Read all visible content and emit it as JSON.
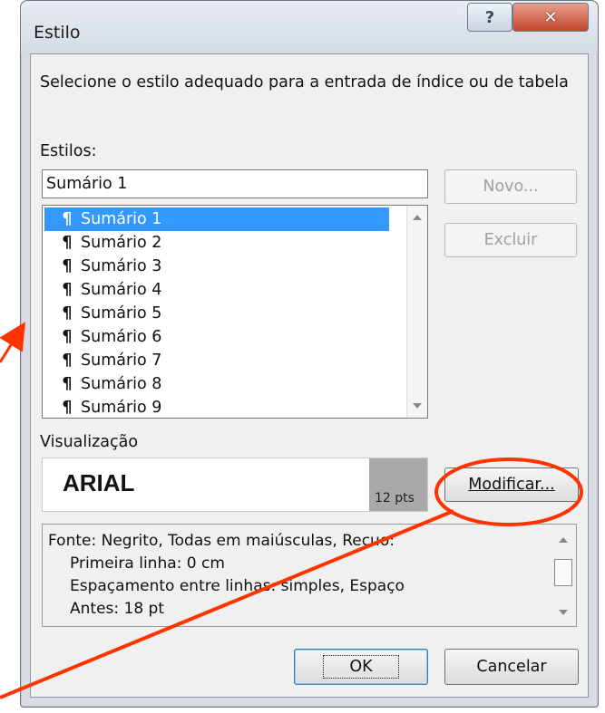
{
  "window": {
    "title": "Estilo"
  },
  "instruction": "Selecione o estilo adequado para a entrada de índice ou de tabela",
  "styles_label": "Estilos:",
  "style_input_value": "Sumário 1",
  "style_list": [
    "Sumário 1",
    "Sumário 2",
    "Sumário 3",
    "Sumário 4",
    "Sumário 5",
    "Sumário 6",
    "Sumário 7",
    "Sumário 8",
    "Sumário 9"
  ],
  "selected_index": 0,
  "buttons": {
    "novo": "Novo...",
    "excluir": "Excluir",
    "modificar": "Modificar...",
    "ok": "OK",
    "cancelar": "Cancelar"
  },
  "preview": {
    "label": "Visualização",
    "sample_text": "ARIAL",
    "size": "12 pts"
  },
  "description_lines": [
    "Fonte: Negrito, Todas em maiúsculas, Recuo:",
    "Primeira linha:  0 cm",
    "Espaçamento entre linhas:  simples, Espaço",
    "Antes:  18 pt"
  ],
  "colors": {
    "selection": "#3399ff",
    "annotation": "#ff3300"
  }
}
